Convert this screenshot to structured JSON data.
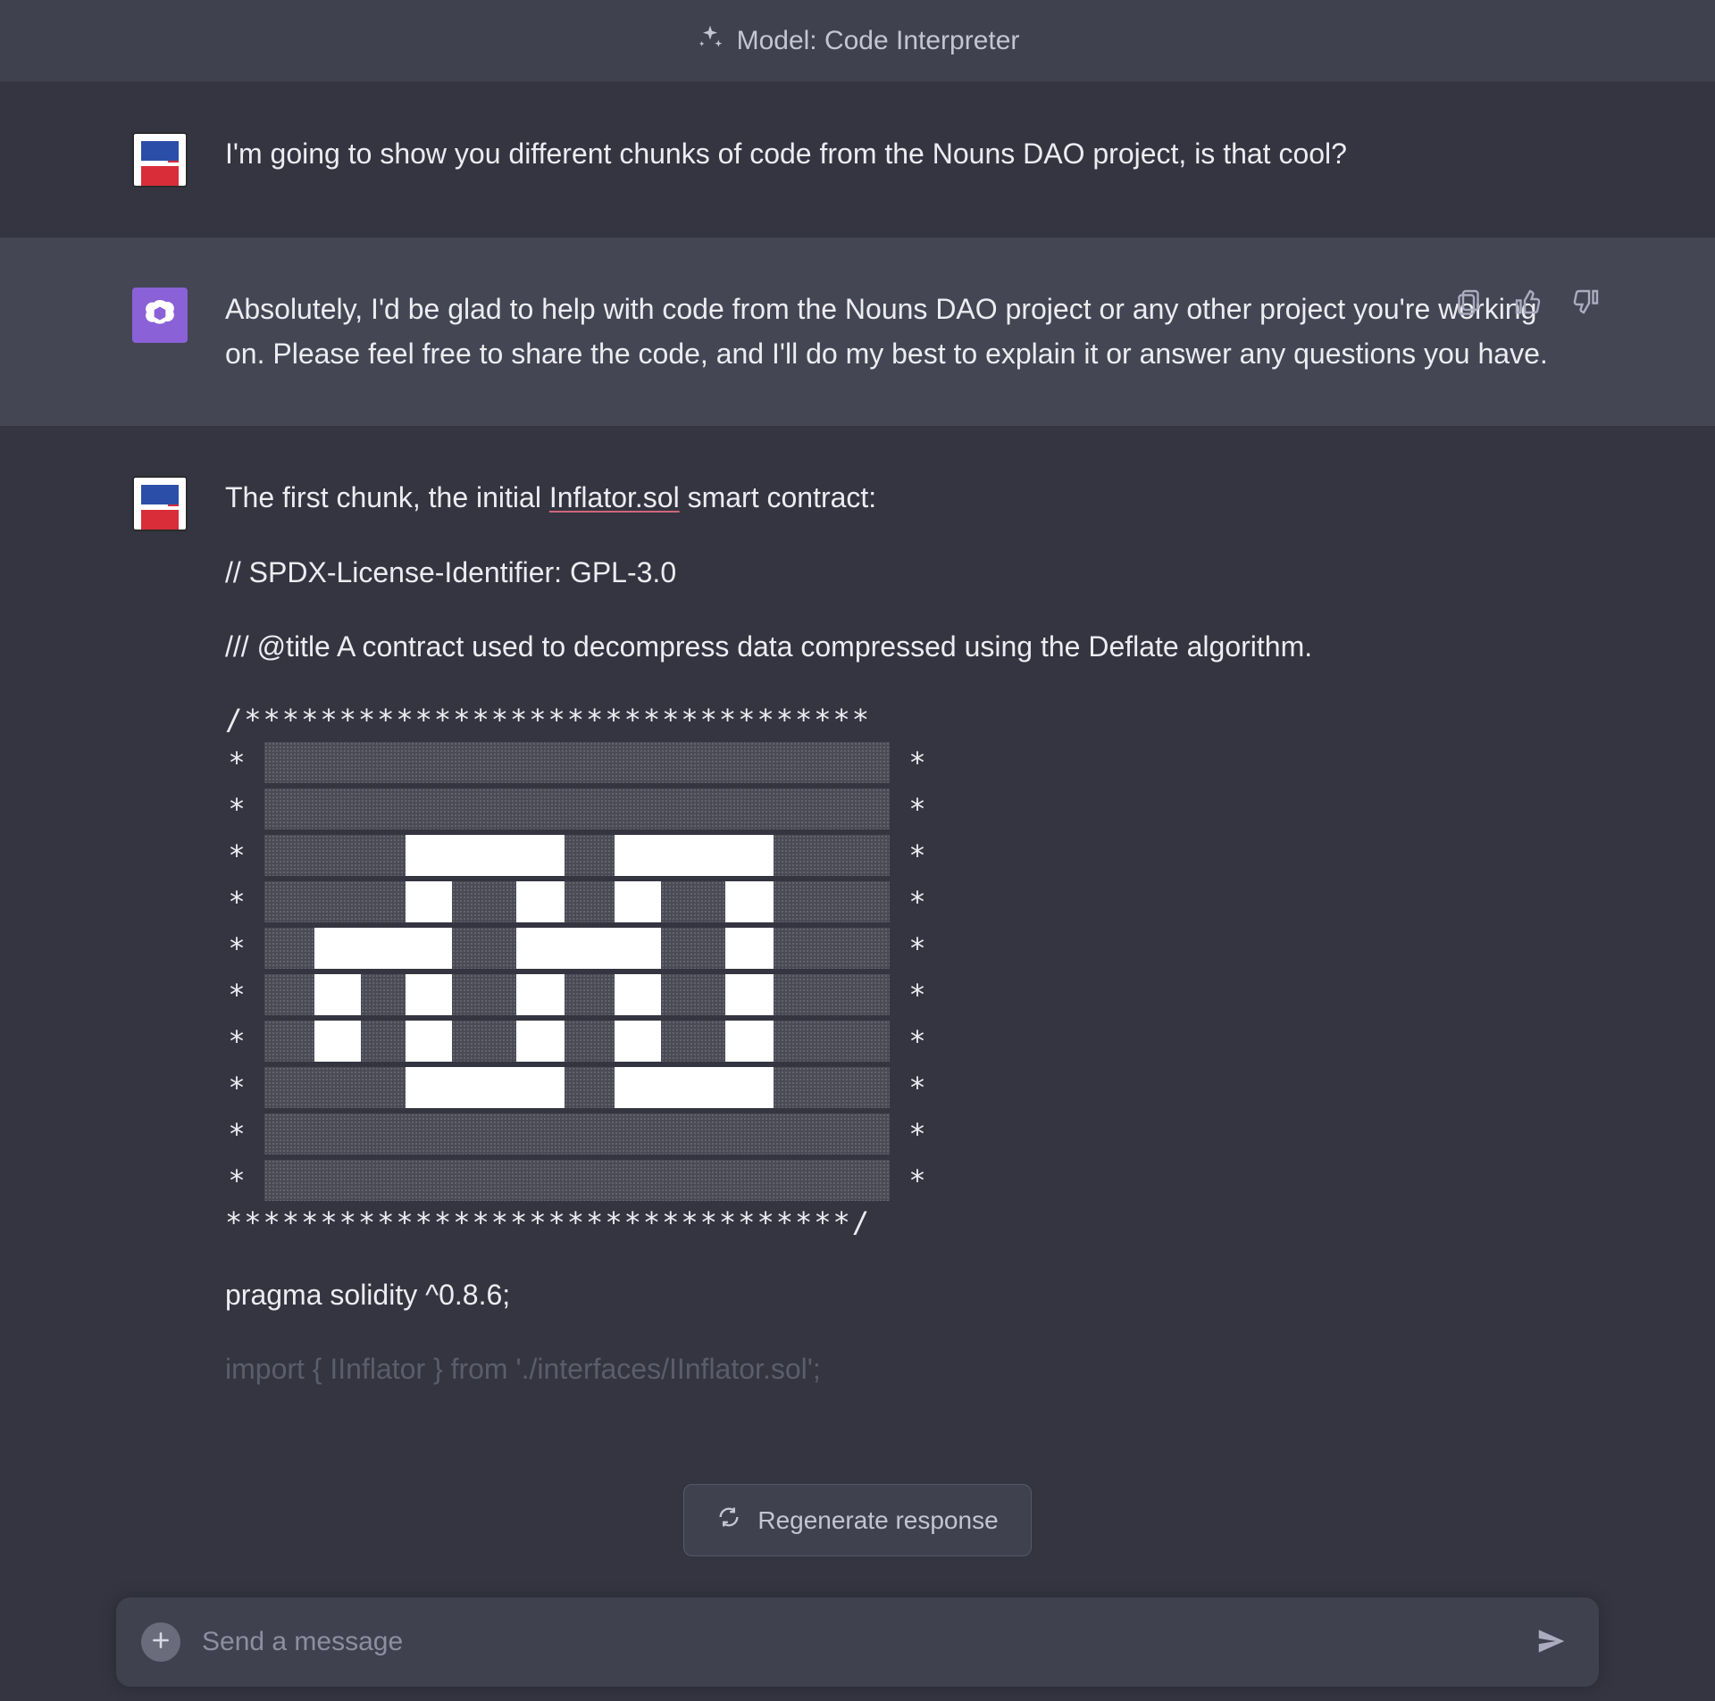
{
  "header": {
    "model_label": "Model: Code Interpreter"
  },
  "messages": {
    "user1": "I'm going to show you different chunks of code from the Nouns DAO project, is that cool?",
    "assistant1": "Absolutely, I'd be glad to help with code from the Nouns DAO project or any other project you're working on. Please feel free to share the code, and I'll do my best to explain it or answer any questions you have.",
    "user2": {
      "intro_prefix": "The first chunk, the initial ",
      "intro_underlined": "Inflator.sol",
      "intro_suffix": " smart contract:",
      "line_license": "// SPDX-License-Identifier: GPL-3.0",
      "line_title": "/// @title A contract used to decompress data compressed using the Deflate algorithm.",
      "ascii_top": "/*********************************",
      "ascii_bottom": "*********************************/",
      "pragma": "pragma solidity ^0.8.6;",
      "import_line": "import { IInflator } from './interfaces/IInflator.sol';"
    }
  },
  "actions": {
    "regenerate": "Regenerate response"
  },
  "input": {
    "placeholder": "Send a message"
  }
}
